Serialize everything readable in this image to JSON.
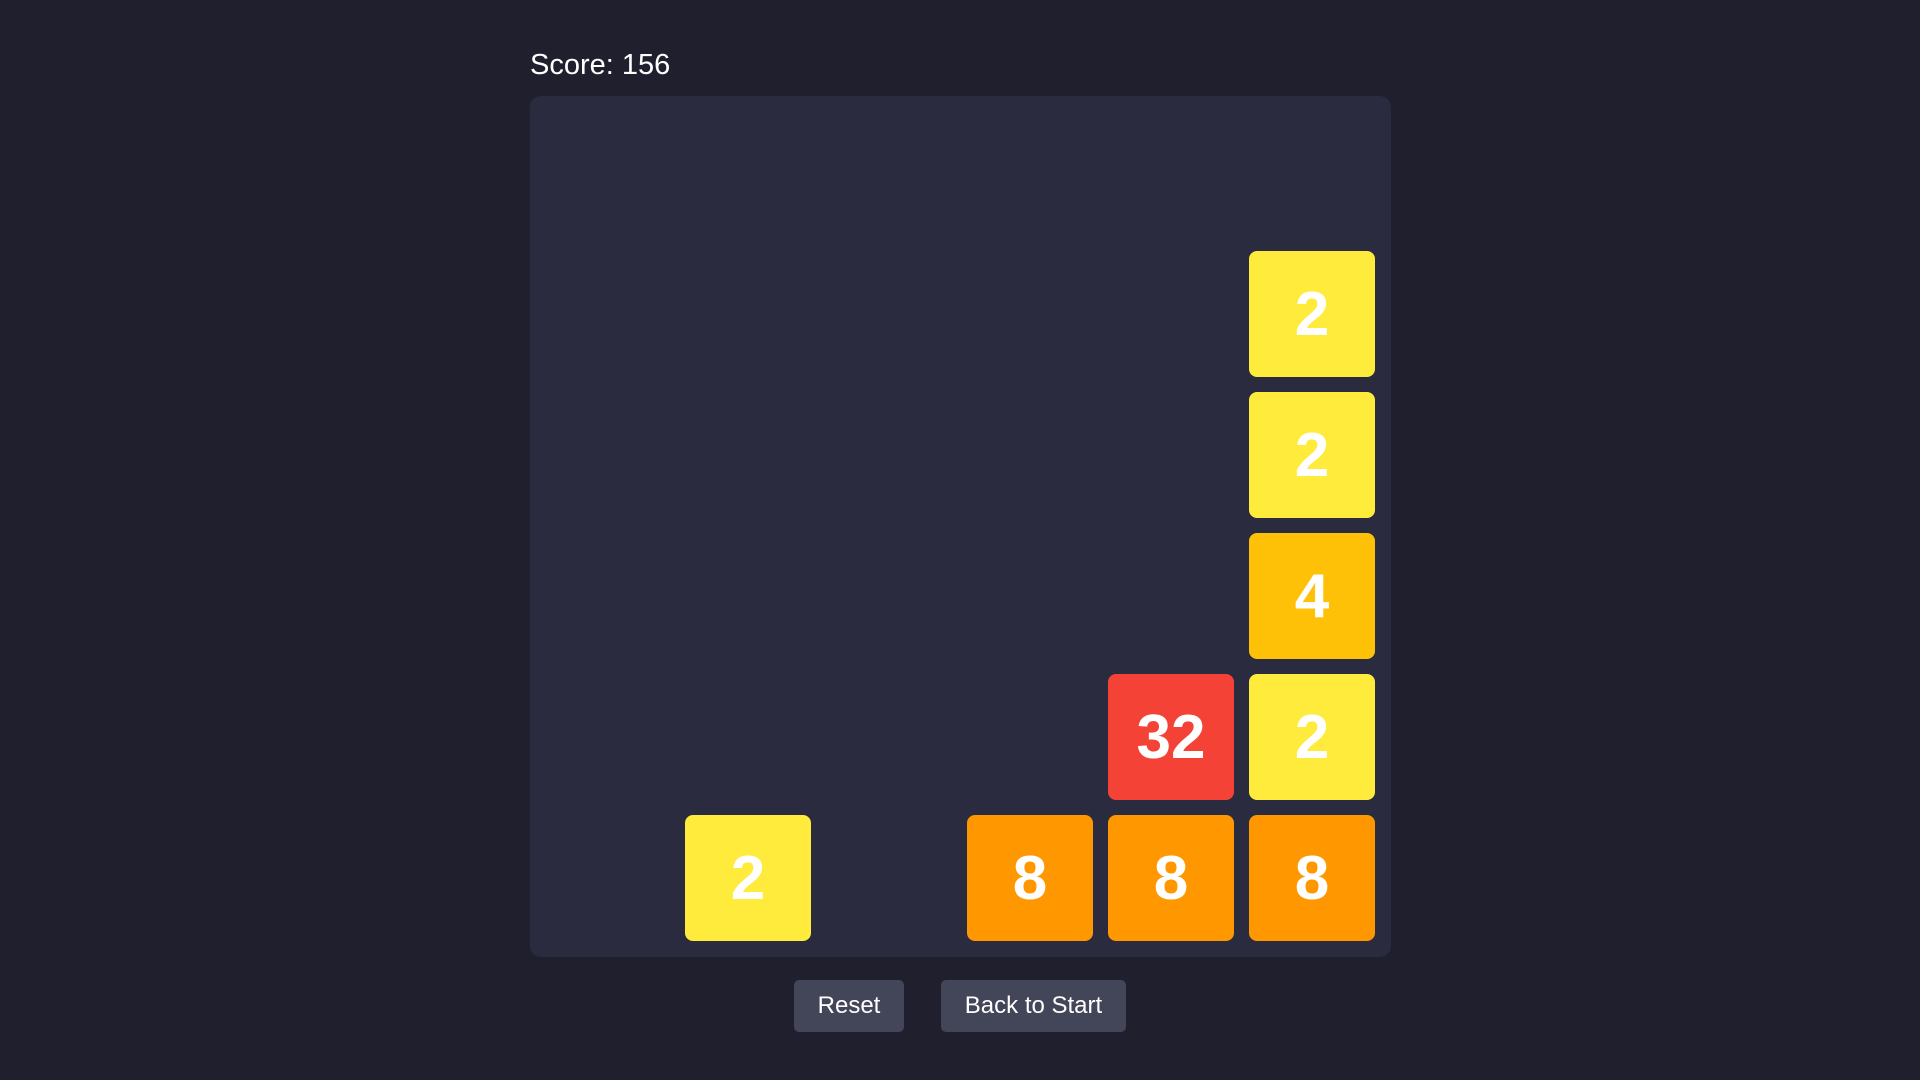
{
  "score": {
    "text": "Score: 156"
  },
  "board": {
    "rows": 6,
    "cols": 6,
    "tiles": [
      {
        "value": "2",
        "row": 1,
        "col": 5,
        "color": "#ffeb3b"
      },
      {
        "value": "2",
        "row": 2,
        "col": 5,
        "color": "#ffeb3b"
      },
      {
        "value": "4",
        "row": 3,
        "col": 5,
        "color": "#ffc107"
      },
      {
        "value": "32",
        "row": 4,
        "col": 4,
        "color": "#f44336"
      },
      {
        "value": "2",
        "row": 4,
        "col": 5,
        "color": "#ffeb3b"
      },
      {
        "value": "2",
        "row": 5,
        "col": 1,
        "color": "#ffeb3b"
      },
      {
        "value": "8",
        "row": 5,
        "col": 3,
        "color": "#ff9800"
      },
      {
        "value": "8",
        "row": 5,
        "col": 4,
        "color": "#ff9800"
      },
      {
        "value": "8",
        "row": 5,
        "col": 5,
        "color": "#ff9800"
      }
    ]
  },
  "buttons": {
    "reset_label": "Reset",
    "back_label": "Back to Start"
  }
}
